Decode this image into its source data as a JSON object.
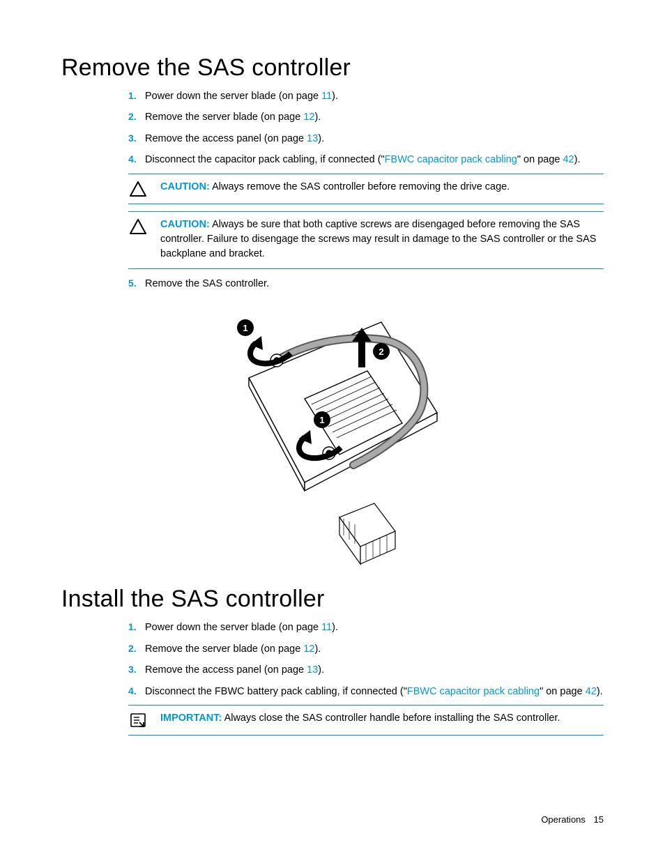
{
  "section1": {
    "heading": "Remove the SAS controller",
    "steps": [
      {
        "n": "1.",
        "pre": "Power down the server blade (on page ",
        "page": "11",
        "post": ")."
      },
      {
        "n": "2.",
        "pre": "Remove the server blade (on page ",
        "page": "12",
        "post": ")."
      },
      {
        "n": "3.",
        "pre": "Remove the access panel (on page ",
        "page": "13",
        "post": ")."
      },
      {
        "n": "4.",
        "pre": "Disconnect the capacitor pack cabling, if connected (\"",
        "xref": "FBWC capacitor pack cabling",
        "mid": "\" on page ",
        "page": "42",
        "post": ")."
      }
    ],
    "caution1": {
      "label": "CAUTION:",
      "text": "  Always remove the SAS controller before removing the drive cage."
    },
    "caution2": {
      "label": "CAUTION:",
      "text": "  Always be sure that both captive screws are disengaged before removing the SAS controller. Failure to disengage the screws may result in damage to the SAS controller or the SAS backplane and bracket."
    },
    "step5": {
      "n": "5.",
      "text": "Remove the SAS controller."
    }
  },
  "section2": {
    "heading": "Install the SAS controller",
    "steps": [
      {
        "n": "1.",
        "pre": "Power down the server blade (on page ",
        "page": "11",
        "post": ")."
      },
      {
        "n": "2.",
        "pre": "Remove the server blade (on page ",
        "page": "12",
        "post": ")."
      },
      {
        "n": "3.",
        "pre": "Remove the access panel (on page ",
        "page": "13",
        "post": ")."
      },
      {
        "n": "4.",
        "pre": "Disconnect the FBWC battery pack cabling, if connected (\"",
        "xref": "FBWC capacitor pack cabling",
        "mid": "\" on page ",
        "page": "42",
        "post": ")."
      }
    ],
    "important": {
      "label": "IMPORTANT:",
      "text": "  Always close the SAS controller handle before installing the SAS controller."
    }
  },
  "footer": {
    "section": "Operations",
    "page": "15"
  },
  "diagram": {
    "callout1": "1",
    "callout2": "2"
  }
}
